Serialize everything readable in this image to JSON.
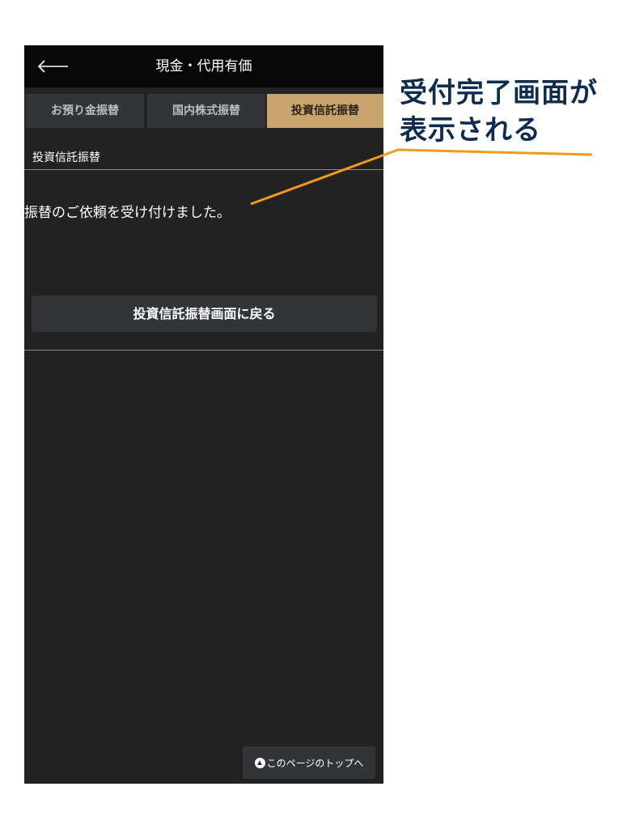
{
  "header": {
    "title": "現金・代用有価",
    "back_icon": "arrow-left-icon"
  },
  "tabs": [
    {
      "label": "お預り金振替",
      "active": false
    },
    {
      "label": "国内株式振替",
      "active": false
    },
    {
      "label": "投資信託振替",
      "active": true
    }
  ],
  "section": {
    "label": "投資信託振替"
  },
  "content": {
    "message": "振替のご依頼を受け付けました。",
    "return_button_label": "投資信託振替画面に戻る"
  },
  "footer": {
    "page_top_label": "このページのトップへ",
    "page_top_icon": "arrow-up-circle-icon"
  },
  "annotation": {
    "line1": "受付完了画面が",
    "line2": "表示される",
    "text_color": "#0d2c4e",
    "line_color": "#f39a1e"
  },
  "colors": {
    "background": "#222222",
    "header_bg": "#080808",
    "tab_inactive": "#333438",
    "tab_active": "#c9a46f"
  }
}
